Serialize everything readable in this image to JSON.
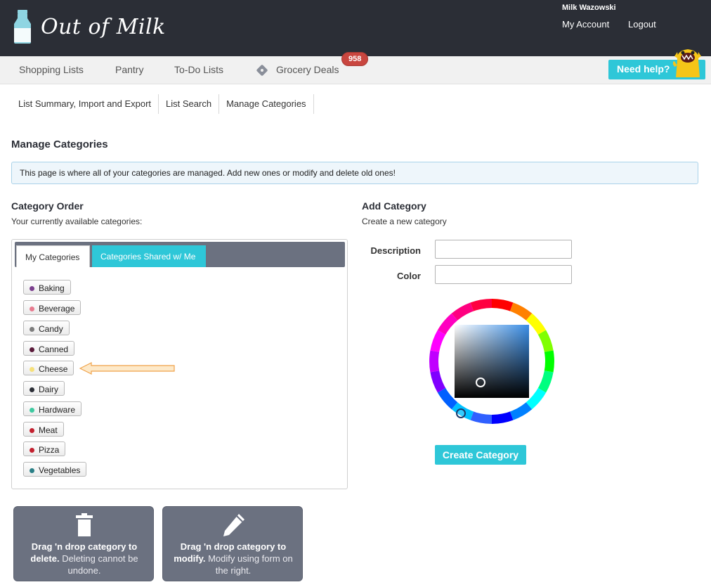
{
  "header": {
    "logo_text": "Out of Milk",
    "user_name": "Milk Wazowski",
    "my_account": "My Account",
    "logout": "Logout"
  },
  "nav": {
    "shopping_lists": "Shopping Lists",
    "pantry": "Pantry",
    "todo_lists": "To-Do Lists",
    "grocery_deals": "Grocery Deals",
    "deals_badge": "958",
    "need_help": "Need help?"
  },
  "subnav": {
    "items": [
      "List Summary, Import and Export",
      "List Search",
      "Manage Categories"
    ]
  },
  "page": {
    "title": "Manage Categories",
    "info": "This page is where all of your categories are managed. Add new ones or modify and delete old ones!"
  },
  "category_order": {
    "heading": "Category Order",
    "subheading": "Your currently available categories:",
    "tabs": [
      "My Categories",
      "Categories Shared w/ Me"
    ],
    "categories": [
      {
        "name": "Baking",
        "color": "#7b3f8e"
      },
      {
        "name": "Beverage",
        "color": "#e77b8f"
      },
      {
        "name": "Candy",
        "color": "#7d7d7d"
      },
      {
        "name": "Canned",
        "color": "#5a1a3a"
      },
      {
        "name": "Cheese",
        "color": "#f6e07a"
      },
      {
        "name": "Dairy",
        "color": "#2b2e36"
      },
      {
        "name": "Hardware",
        "color": "#3ec9a0"
      },
      {
        "name": "Meat",
        "color": "#c3202f"
      },
      {
        "name": "Pizza",
        "color": "#c3202f"
      },
      {
        "name": "Vegetables",
        "color": "#2a7f86"
      }
    ]
  },
  "dropzones": {
    "delete_bold": "Drag 'n drop category to delete.",
    "delete_rest": " Deleting cannot be undone.",
    "modify_bold": "Drag 'n drop category to modify.",
    "modify_rest": " Modify using form on the right."
  },
  "add_category": {
    "heading": "Add Category",
    "subheading": "Create a new category",
    "description_label": "Description",
    "description_value": "",
    "color_label": "Color",
    "color_value": "",
    "create_button": "Create Category"
  },
  "colors": {
    "header_bg": "#2b2e36",
    "accent": "#2ec7d8",
    "badge": "#c9463f",
    "dropzone": "#6b7180"
  }
}
